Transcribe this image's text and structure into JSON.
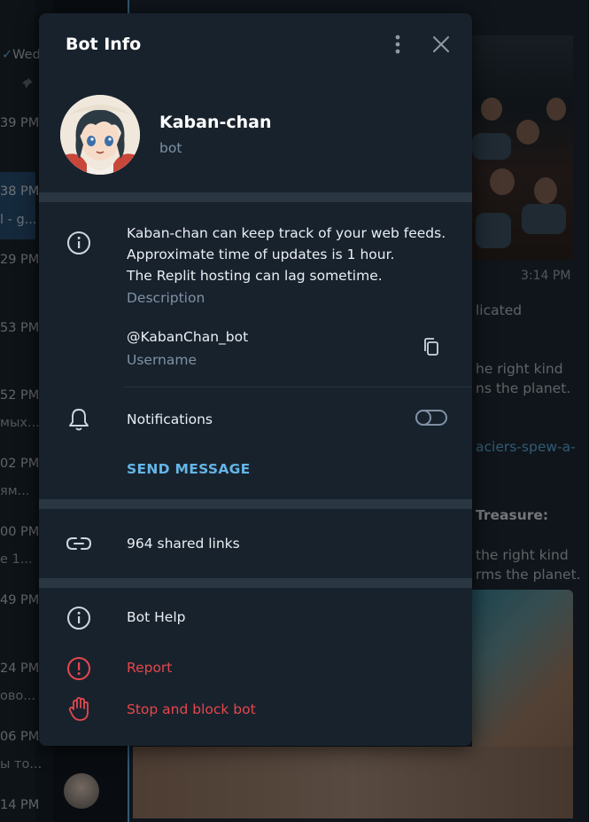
{
  "background": {
    "chat_list_times": [
      "Wed",
      "39 PM",
      "38 PM",
      "29 PM",
      "53 PM",
      "52 PM",
      "02 PM",
      "00 PM",
      "49 PM",
      "24 PM",
      "06 PM",
      "14 PM"
    ],
    "chat_list_snippets": [
      "l - g...",
      "мых...",
      "ям...",
      "e 1...",
      "ово...",
      "ы то..."
    ],
    "message_time": "3:14 PM",
    "message_fragments": [
      "licated",
      "he right kind",
      "ns the planet.",
      "aciers-spew-a-",
      "Treasure:",
      "the right kind",
      "rms the planet."
    ]
  },
  "dialog": {
    "title": "Bot Info",
    "bot_name": "Kaban-chan",
    "bot_type": "bot",
    "description_lines": [
      "Kaban-chan can keep track of your web feeds.",
      "Approximate time of updates is 1 hour.",
      "The Replit hosting can lag sometime."
    ],
    "description_label": "Description",
    "username": "@KabanChan_bot",
    "username_label": "Username",
    "notifications_label": "Notifications",
    "notifications_enabled": false,
    "send_message_label": "SEND MESSAGE",
    "shared_links_label": "964 shared links",
    "bot_help_label": "Bot Help",
    "report_label": "Report",
    "stop_block_label": "Stop and block bot"
  },
  "colors": {
    "accent": "#64b5e6",
    "danger": "#e5474c",
    "dialog_bg": "#18222d",
    "secondary_text": "#7f91a4"
  },
  "icons": [
    "more-vertical-icon",
    "close-icon",
    "info-icon",
    "copy-icon",
    "bell-icon",
    "link-icon",
    "info-icon",
    "report-icon",
    "hand-stop-icon"
  ]
}
